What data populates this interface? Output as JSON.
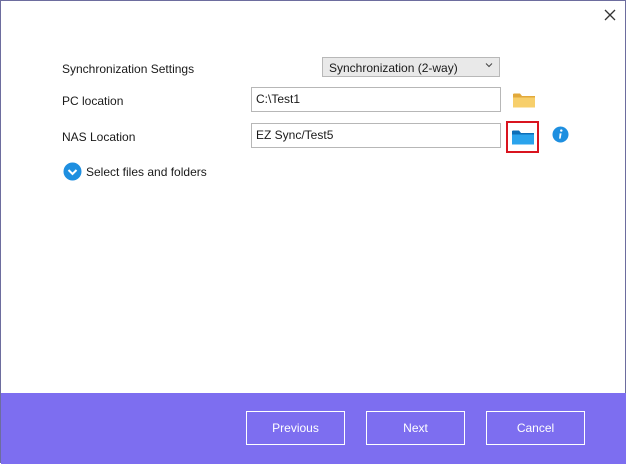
{
  "dialog": {
    "close_icon": "close-icon"
  },
  "form": {
    "sync_settings_label": "Synchronization Settings",
    "sync_settings_value": "Synchronization (2-way)",
    "pc_location_label": "PC location",
    "pc_location_value": "C:\\Test1",
    "nas_location_label": "NAS Location",
    "nas_location_value": "EZ Sync/Test5",
    "select_files_label": "Select files and folders"
  },
  "icons": {
    "pc_folder": "folder-icon",
    "nas_folder": "folder-icon",
    "info": "info-icon",
    "expand": "chevron-down-circle-icon"
  },
  "colors": {
    "footer": "#7d6ef0",
    "highlight": "#d9141f",
    "accent_blue": "#1e8fe0",
    "folder_yellow": "#f4c95d"
  },
  "footer": {
    "previous_label": "Previous",
    "next_label": "Next",
    "cancel_label": "Cancel"
  }
}
